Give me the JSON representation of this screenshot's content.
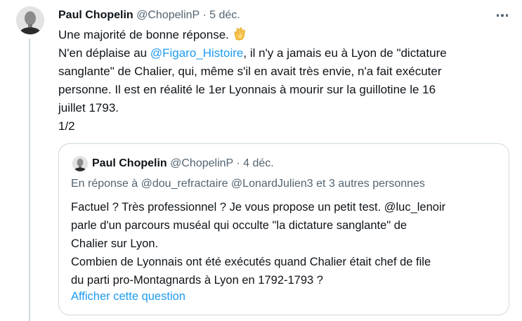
{
  "tweet": {
    "author_name": "Paul Chopelin",
    "author_handle": "@ChopelinP",
    "separator": "·",
    "date": "5 déc.",
    "more_icon": "more-horizontal-icon",
    "line1": "Une majorité de bonne réponse.",
    "emoji": "clapping-hands-icon",
    "line2_prefix": "N'en déplaise au ",
    "mention": "@Figaro_Histoire",
    "line2_suffix": ", il n'y a jamais eu à Lyon de \"dictature",
    "line3": "sanglante\" de Chalier, qui, même s'il en avait très envie, n'a fait exécuter",
    "line4": "personne. Il est en réalité le 1er Lyonnais à mourir sur la guillotine le 16",
    "line5": "juillet 1793.",
    "line6": "1/2"
  },
  "quote": {
    "author_name": "Paul Chopelin",
    "author_handle": "@ChopelinP",
    "separator": "·",
    "date": "4 déc.",
    "reply_prefix": "En réponse à ",
    "reply_users": "@dou_refractaire @LonardJulien3",
    "reply_suffix": " et 3 autres personnes",
    "lines": [
      "Factuel ? Très professionnel ? Je vous propose un petit test. @luc_lenoir",
      "parle d'un parcours muséal qui occulte \"la dictature sanglante\" de",
      "Chalier sur Lyon.",
      "Combien de Lyonnais ont été exécutés quand Chalier était chef de file",
      "du parti pro-Montagnards à Lyon en 1792-1793 ?"
    ],
    "show_link": "Afficher cette question"
  },
  "colors": {
    "link": "#1d9bf0",
    "muted": "#536471",
    "text": "#0f1419",
    "border": "#cfd9de"
  }
}
